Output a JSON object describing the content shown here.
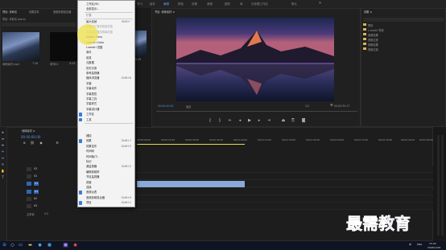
{
  "top_menu_text": "工作区(W) | 全部显示...",
  "top_tabs": [
    "学习",
    "组件",
    "编辑",
    "颜色",
    "效果",
    "音频",
    "图形",
    "库",
    "无标题工作区",
    "默认"
  ],
  "project": {
    "tabs": [
      "项目: 未命名",
      "效果控件",
      "音频剪辑混合器"
    ],
    "title": "项目: 未命名 prproj",
    "clips": [
      {
        "name": "地球素材.mp4",
        "duration": "7:26"
      },
      {
        "name": "序列01",
        "duration": "9:29"
      }
    ],
    "right_clip": {
      "name": "地球素材",
      "duration": "0:29"
    }
  },
  "program": {
    "title": "节目: 地球素材 ≡",
    "timecode": "00:00:00:00",
    "fit": "适合",
    "full": "完整",
    "page": "1/1",
    "duration": "00:04:35:17"
  },
  "effects": {
    "title": "效果 ≡",
    "tree": [
      "预设",
      "Lumetri 预设",
      "音频效果",
      "音频过渡",
      "视频效果",
      "视频过渡"
    ]
  },
  "menu": {
    "top": "工作区(W)",
    "top2": "全部显示...",
    "groups": [
      {
        "label": "扩展",
        "header": true
      },
      {
        "label": "最大化帧",
        "shortcut": "Shift+`"
      },
      {
        "label": "将面板扩展到屏幕范围",
        "disabled": true
      },
      {
        "label": "将框架扩展到屏幕范围",
        "disabled": true
      },
      {
        "label": "Adobe Story"
      },
      {
        "label": "Lumetri Color"
      },
      {
        "label": "Lumetri 范围"
      },
      {
        "label": "事件"
      },
      {
        "label": "信息"
      },
      {
        "label": "元数据"
      },
      {
        "label": "历史记录"
      },
      {
        "label": "参考监视器"
      },
      {
        "label": "媒体浏览器",
        "shortcut": "Shift+8"
      },
      {
        "label": "字幕"
      },
      {
        "label": "字幕动作"
      },
      {
        "label": "字幕属性"
      },
      {
        "label": "字幕工具"
      },
      {
        "label": "字幕样式"
      },
      {
        "label": "字幕设计器"
      },
      {
        "label": "工作区",
        "checked": true
      },
      {
        "label": "工具",
        "checked": true
      },
      {
        "label": "捕捉"
      },
      {
        "label": "效果",
        "shortcut": "Shift+7",
        "checked": true
      },
      {
        "label": "效果控件",
        "shortcut": "Shift+5"
      },
      {
        "label": "时间码"
      },
      {
        "label": "时间轴(T)"
      },
      {
        "label": "标记"
      },
      {
        "label": "源监视器",
        "shortcut": "Shift+2"
      },
      {
        "label": "编辑到磁带"
      },
      {
        "label": "节目监视器"
      },
      {
        "label": "进度"
      },
      {
        "label": "连接"
      },
      {
        "label": "音频仪表",
        "checked": true
      },
      {
        "label": "音频剪辑混合器",
        "shortcut": "Shift+9"
      },
      {
        "label": "项目",
        "shortcut": "Shift+1",
        "checked": true
      }
    ]
  },
  "timeline": {
    "title": "地球素材 ≡",
    "timecode": "00:00:00:00",
    "ruler": [
      "00:00:00:00",
      "00:00:15:00",
      "00:00:30:00",
      "00:00:45:00",
      "00:01:00:00",
      "00:01:15:00",
      "00:01:30:00",
      "00:01:45:00",
      "00:02:00:00",
      "00:02:15:00",
      "00:02:30:00",
      "00:02:45:00",
      "00:03:00:00"
    ],
    "tracks": [
      {
        "label": "V3"
      },
      {
        "label": "V2"
      },
      {
        "label": "V1"
      },
      {
        "label": "A1"
      },
      {
        "label": "A2"
      },
      {
        "label": "A3"
      }
    ],
    "master": "主声道",
    "master_value": "0.0"
  },
  "watermark": "最需教育",
  "taskbar": {
    "lang": "ENG",
    "ime": "中",
    "time": "15:04",
    "date": "2018/12/18"
  },
  "colors": {
    "accent": "#5a9be8",
    "clip": "#8aa8d8",
    "watermark": "#1d3fa6",
    "highlight": "#f0e24a"
  }
}
